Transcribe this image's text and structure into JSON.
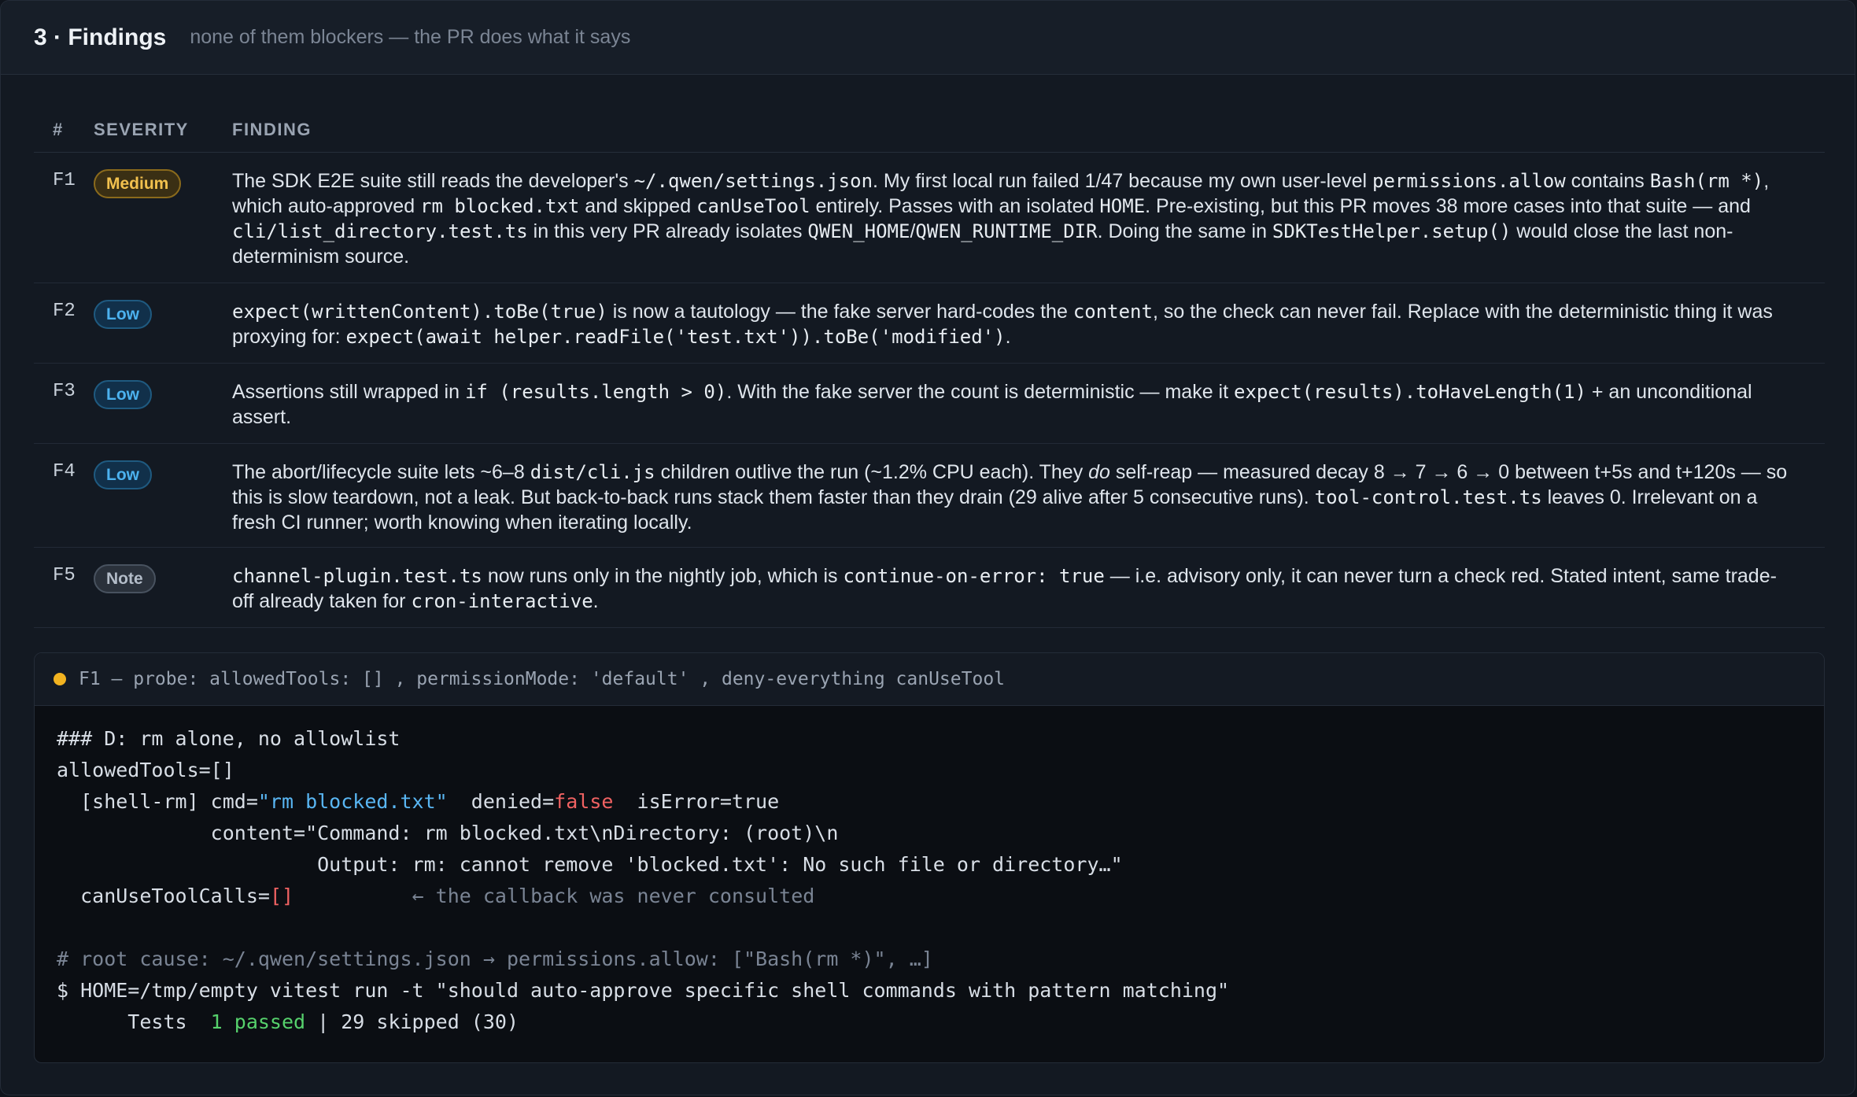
{
  "header": {
    "title": "3 · Findings",
    "subtitle": "none of them blockers — the PR does what it says"
  },
  "table": {
    "columns": [
      "#",
      "SEVERITY",
      "FINDING"
    ],
    "rows": [
      {
        "id": "F1",
        "severity": "Medium",
        "parts": [
          {
            "t": "The SDK E2E suite still reads the developer's "
          },
          {
            "c": "~/.qwen/settings.json"
          },
          {
            "t": ". My first local run failed 1/47 because my own user-level "
          },
          {
            "c": "permissions.allow"
          },
          {
            "t": " contains "
          },
          {
            "c": "Bash(rm *)"
          },
          {
            "t": ", which auto-approved "
          },
          {
            "c": "rm blocked.txt"
          },
          {
            "t": " and skipped "
          },
          {
            "c": "canUseTool"
          },
          {
            "t": " entirely. Passes with an isolated "
          },
          {
            "c": "HOME"
          },
          {
            "t": ". Pre-existing, but this PR moves 38 more cases into that suite — and "
          },
          {
            "c": "cli/list_directory.test.ts"
          },
          {
            "t": " in this very PR already isolates "
          },
          {
            "c": "QWEN_HOME"
          },
          {
            "t": "/"
          },
          {
            "c": "QWEN_RUNTIME_DIR"
          },
          {
            "t": ". Doing the same in "
          },
          {
            "c": "SDKTestHelper.setup()"
          },
          {
            "t": " would close the last non-determinism source."
          }
        ]
      },
      {
        "id": "F2",
        "severity": "Low",
        "parts": [
          {
            "c": "expect(writtenContent).toBe(true)"
          },
          {
            "t": " is now a tautology — the fake server hard-codes the "
          },
          {
            "c": "content"
          },
          {
            "t": ", so the check can never fail. Replace with the deterministic thing it was proxying for: "
          },
          {
            "c": "expect(await helper.readFile('test.txt')).toBe('modified')"
          },
          {
            "t": "."
          }
        ]
      },
      {
        "id": "F3",
        "severity": "Low",
        "parts": [
          {
            "t": "Assertions still wrapped in "
          },
          {
            "c": "if (results.length > 0)"
          },
          {
            "t": ". With the fake server the count is deterministic — make it "
          },
          {
            "c": "expect(results).toHaveLength(1)"
          },
          {
            "t": " + an unconditional assert."
          }
        ]
      },
      {
        "id": "F4",
        "severity": "Low",
        "parts": [
          {
            "t": "The abort/lifecycle suite lets ~6–8 "
          },
          {
            "c": "dist/cli.js"
          },
          {
            "t": " children outlive the run (~1.2% CPU each). They "
          },
          {
            "e": "do"
          },
          {
            "t": " self-reap — measured decay 8 → 7 → 6 → 0 between t+5s and t+120s — so this is slow teardown, not a leak. But back-to-back runs stack them faster than they drain (29 alive after 5 consecutive runs). "
          },
          {
            "c": "tool-control.test.ts"
          },
          {
            "t": " leaves 0. Irrelevant on a fresh CI runner; worth knowing when iterating locally."
          }
        ]
      },
      {
        "id": "F5",
        "severity": "Note",
        "parts": [
          {
            "c": "channel-plugin.test.ts"
          },
          {
            "t": " now runs only in the nightly job, which is "
          },
          {
            "c": "continue-on-error: true"
          },
          {
            "t": " — i.e. advisory only, it can never turn a check red. Stated intent, same trade-off already taken for "
          },
          {
            "c": "cron-interactive"
          },
          {
            "t": "."
          }
        ]
      }
    ]
  },
  "terminal": {
    "title": "F1 — probe: allowedTools: [] , permissionMode: 'default' , deny-everything canUseTool",
    "lines": [
      [
        {
          "t": "### D: rm alone, no allowlist"
        }
      ],
      [
        {
          "t": "allowedTools=[]"
        }
      ],
      [
        {
          "t": "  [shell-rm] cmd="
        },
        {
          "t": "\"rm blocked.txt\"",
          "s": "blue"
        },
        {
          "t": "  denied="
        },
        {
          "t": "false",
          "s": "red"
        },
        {
          "t": "  isError=true"
        }
      ],
      [
        {
          "t": "             content=\"Command: rm blocked.txt\\nDirectory: (root)\\n"
        }
      ],
      [
        {
          "t": "                      Output: rm: cannot remove 'blocked.txt': No such file or directory…\""
        }
      ],
      [
        {
          "t": "  canUseToolCalls="
        },
        {
          "t": "[]",
          "s": "red"
        },
        {
          "t": "          ← the callback was never consulted",
          "s": "dim"
        }
      ],
      [
        {
          "t": ""
        }
      ],
      [
        {
          "t": "# root cause: ~/.qwen/settings.json → permissions.allow: [\"Bash(rm *)\", …]",
          "s": "dim"
        }
      ],
      [
        {
          "t": "$ HOME=/tmp/empty vitest run -t \"should auto-approve specific shell commands with pattern matching\""
        }
      ],
      [
        {
          "t": "      Tests  "
        },
        {
          "t": "1 passed",
          "s": "green"
        },
        {
          "t": " | 29 skipped (30)"
        }
      ]
    ]
  },
  "colors": {
    "background": "#131922",
    "medium": "#f2c14e",
    "low": "#4cb2ef",
    "note": "#b3bcc8",
    "accent_dot": "#f2b320"
  }
}
